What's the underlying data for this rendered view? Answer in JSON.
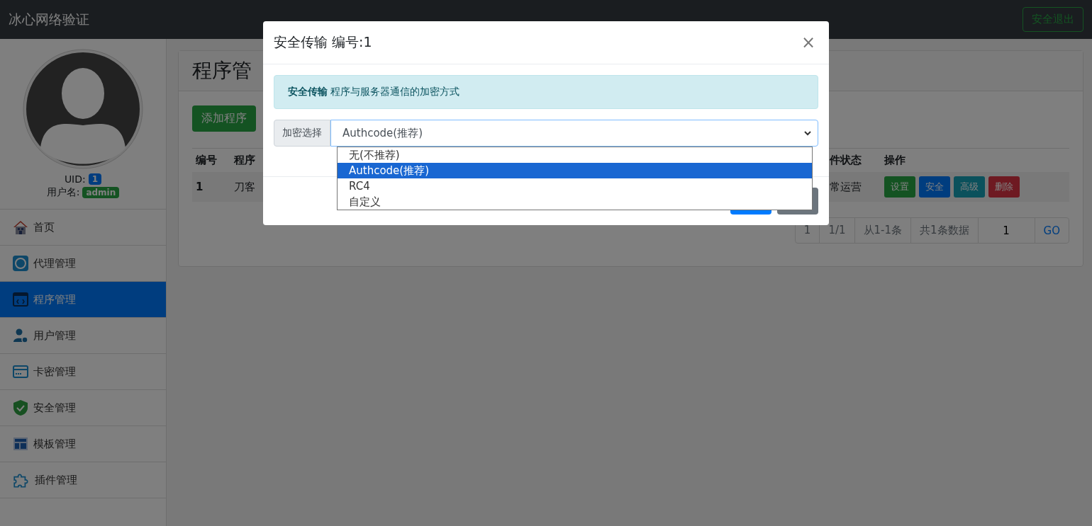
{
  "navbar": {
    "brand": "冰心网络验证",
    "logout": "安全退出"
  },
  "sidebar": {
    "uid_label": "UID:",
    "uid": "1",
    "username_label": "用户名:",
    "username": "admin",
    "items": [
      {
        "label": "首页",
        "selected": false
      },
      {
        "label": "代理管理",
        "selected": false
      },
      {
        "label": "程序管理",
        "selected": true
      },
      {
        "label": "用户管理",
        "selected": false
      },
      {
        "label": "卡密管理",
        "selected": false
      },
      {
        "label": "安全管理",
        "selected": false
      },
      {
        "label": "模板管理",
        "selected": false
      },
      {
        "label": "插件管理",
        "selected": false
      }
    ]
  },
  "page": {
    "title": "程序管",
    "add_button": "添加程序",
    "table": {
      "columns": [
        "编号",
        "程序",
        "件状态",
        "操作"
      ],
      "rows": [
        {
          "cells": [
            "1",
            "刀客",
            "常运营"
          ],
          "actions": [
            {
              "label": "设置",
              "kind": "success"
            },
            {
              "label": "安全",
              "kind": "primary"
            },
            {
              "label": "高级",
              "kind": "info"
            },
            {
              "label": "删除",
              "kind": "danger"
            }
          ]
        }
      ]
    },
    "pagination": {
      "first": "1",
      "pages": "1/1",
      "range": "从1-1条",
      "total": "共1条数据",
      "page_input": "1",
      "go": "GO"
    }
  },
  "modal": {
    "title": "安全传输 编号:1",
    "close": "×",
    "alert": "**安全传输** 程序与服务器通信的加密方式",
    "select_label": "加密选择",
    "value": "Authcode(推荐)",
    "options": [
      {
        "label": "无(不推荐)",
        "selected": false
      },
      {
        "label": "Authcode(推荐)",
        "selected": true
      },
      {
        "label": "RC4",
        "selected": false
      },
      {
        "label": "自定义",
        "selected": false
      }
    ],
    "footer_buttons": [
      {
        "kind": "primary"
      },
      {
        "kind": "secondary"
      }
    ]
  }
}
